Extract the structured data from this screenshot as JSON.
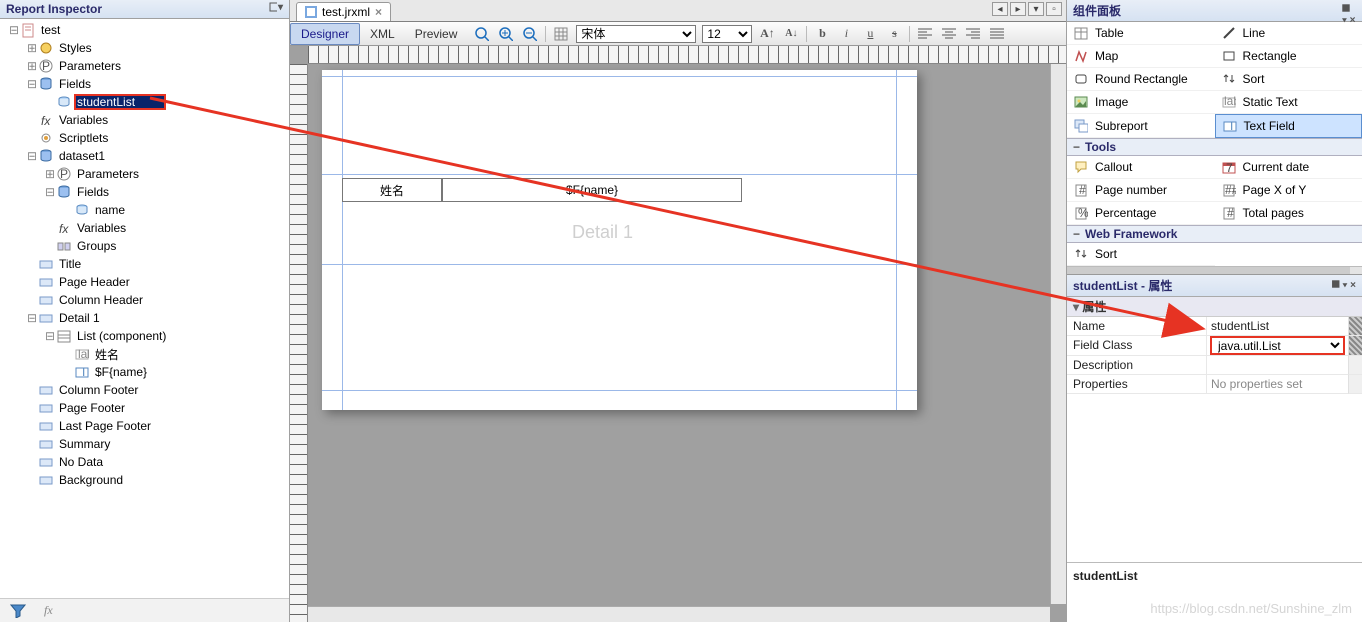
{
  "left": {
    "title": "Report Inspector",
    "tree": [
      {
        "label": "test",
        "depth": 0,
        "tw": "−",
        "icon": "report"
      },
      {
        "label": "Styles",
        "depth": 1,
        "tw": "+",
        "icon": "style"
      },
      {
        "label": "Parameters",
        "depth": 1,
        "tw": "+",
        "icon": "param"
      },
      {
        "label": "Fields",
        "depth": 1,
        "tw": "−",
        "icon": "db"
      },
      {
        "label": "studentList",
        "depth": 2,
        "tw": "",
        "icon": "field",
        "selected": true,
        "hl": true
      },
      {
        "label": "Variables",
        "depth": 1,
        "tw": "",
        "icon": "fx"
      },
      {
        "label": "Scriptlets",
        "depth": 1,
        "tw": "",
        "icon": "scriptlet"
      },
      {
        "label": "dataset1",
        "depth": 1,
        "tw": "−",
        "icon": "db"
      },
      {
        "label": "Parameters",
        "depth": 2,
        "tw": "+",
        "icon": "param"
      },
      {
        "label": "Fields",
        "depth": 2,
        "tw": "−",
        "icon": "db"
      },
      {
        "label": "name",
        "depth": 3,
        "tw": "",
        "icon": "field"
      },
      {
        "label": "Variables",
        "depth": 2,
        "tw": "",
        "icon": "fx"
      },
      {
        "label": "Groups",
        "depth": 2,
        "tw": "",
        "icon": "group"
      },
      {
        "label": "Title",
        "depth": 1,
        "tw": "",
        "icon": "band"
      },
      {
        "label": "Page Header",
        "depth": 1,
        "tw": "",
        "icon": "band"
      },
      {
        "label": "Column Header",
        "depth": 1,
        "tw": "",
        "icon": "band"
      },
      {
        "label": "Detail 1",
        "depth": 1,
        "tw": "−",
        "icon": "band"
      },
      {
        "label": "List (component)",
        "depth": 2,
        "tw": "−",
        "icon": "list"
      },
      {
        "label": "姓名",
        "depth": 3,
        "tw": "",
        "icon": "labelic"
      },
      {
        "label": "$F{name}",
        "depth": 3,
        "tw": "",
        "icon": "textfield"
      },
      {
        "label": "Column Footer",
        "depth": 1,
        "tw": "",
        "icon": "band"
      },
      {
        "label": "Page Footer",
        "depth": 1,
        "tw": "",
        "icon": "band"
      },
      {
        "label": "Last Page Footer",
        "depth": 1,
        "tw": "",
        "icon": "band"
      },
      {
        "label": "Summary",
        "depth": 1,
        "tw": "",
        "icon": "band"
      },
      {
        "label": "No Data",
        "depth": 1,
        "tw": "",
        "icon": "band"
      },
      {
        "label": "Background",
        "depth": 1,
        "tw": "",
        "icon": "band"
      }
    ]
  },
  "center": {
    "tab": "test.jrxml",
    "subtabs": [
      "Designer",
      "XML",
      "Preview"
    ],
    "font_family": "宋体",
    "font_size": "12",
    "cell1": "姓名",
    "cell2": "$F{name}",
    "detail_label": "Detail 1"
  },
  "right": {
    "palette_title": "组件面板",
    "items_main": [
      [
        "Table",
        "table"
      ],
      [
        "Line",
        "line"
      ],
      [
        "Map",
        "map"
      ],
      [
        "Rectangle",
        "rect"
      ],
      [
        "Round Rectangle",
        "rrect"
      ],
      [
        "Sort",
        "sort"
      ],
      [
        "Image",
        "image"
      ],
      [
        "Static Text",
        "static"
      ],
      [
        "Subreport",
        "subreport"
      ],
      [
        "Text Field",
        "textfield"
      ]
    ],
    "cat_tools": "Tools",
    "items_tools": [
      [
        "Callout",
        "callout"
      ],
      [
        "Current date",
        "date"
      ],
      [
        "Page number",
        "pnum"
      ],
      [
        "Page X of Y",
        "pxy"
      ],
      [
        "Percentage",
        "pct"
      ],
      [
        "Total pages",
        "tpages"
      ]
    ],
    "cat_web": "Web Framework",
    "web_items": [
      [
        "Sort",
        "sort"
      ]
    ],
    "prop_title": "studentList - 属性",
    "prop_cat": "属性",
    "props": {
      "Name": "studentList",
      "Field Class": "java.util.List",
      "Description": "",
      "Properties": "No properties set"
    },
    "footer_name": "studentList"
  },
  "watermark": "https://blog.csdn.net/Sunshine_zlm"
}
